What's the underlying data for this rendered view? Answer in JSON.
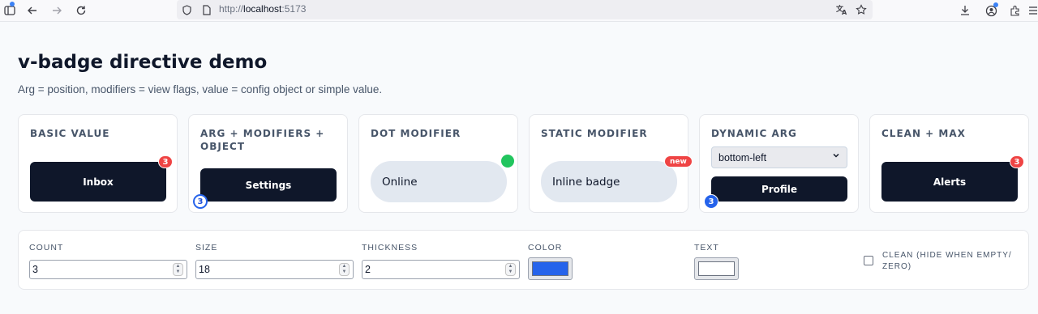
{
  "browser": {
    "url_prefix": "http://",
    "url_host": "localhost",
    "url_port": ":5173"
  },
  "page": {
    "title": "v-badge directive demo",
    "subtitle": "Arg = position, modifiers = view flags, value = config object or simple value."
  },
  "cards": [
    {
      "title": "Basic value",
      "button": "Inbox",
      "badge": "3"
    },
    {
      "title": "Arg + modifiers + object",
      "button": "Settings",
      "badge": "3"
    },
    {
      "title": "Dot modifier",
      "button": "Online"
    },
    {
      "title": "Static modifier",
      "button": "Inline badge",
      "badge": "new"
    },
    {
      "title": "Dynamic arg",
      "select_value": "bottom-left",
      "button": "Profile",
      "badge": "3"
    },
    {
      "title": "Clean + max",
      "button": "Alerts",
      "badge": "3"
    }
  ],
  "controls": {
    "count": {
      "label": "Count",
      "value": "3"
    },
    "size": {
      "label": "Size",
      "value": "18"
    },
    "thickness": {
      "label": "Thickness",
      "value": "2"
    },
    "color": {
      "label": "Color",
      "value": "#2563eb"
    },
    "text": {
      "label": "Text",
      "value": "#ffffff"
    },
    "clean": {
      "label": "Clean (hide when empty/ zero)",
      "checked": false
    }
  },
  "colors": {
    "badge_red": "#ef4444",
    "badge_blue": "#2563eb",
    "dot_green": "#22c55e",
    "button_dark": "#0f172a",
    "pill": "#e2e8f0"
  }
}
